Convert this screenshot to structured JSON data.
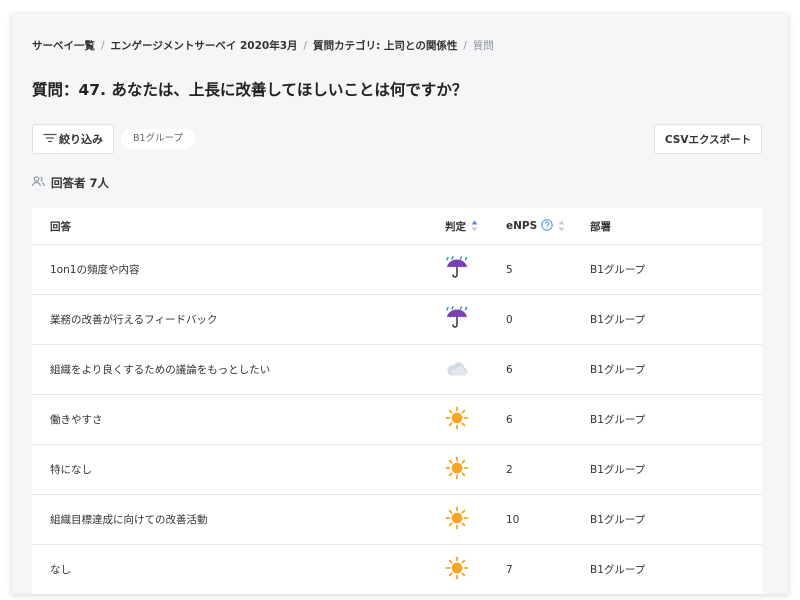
{
  "breadcrumb": {
    "items": [
      "サーベイ一覧",
      "エンゲージメントサーベイ 2020年3月",
      "質問カテゴリ: 上司との関係性"
    ],
    "separator": "/",
    "current": "質問"
  },
  "page_title": "質問：47. あなたは、上長に改善してほしいことは何ですか？",
  "toolbar": {
    "filter_label": "絞り込み",
    "filter_chip": "B1グループ",
    "csv_label": "CSVエクスポート"
  },
  "respondents_label": "回答者 7人",
  "table": {
    "headers": {
      "answer": "回答",
      "judge": "判定",
      "enps": "eNPS",
      "dept": "部署"
    },
    "rows": [
      {
        "answer": "1on1の頻度や内容",
        "judge": "umbrella-rain-icon",
        "enps": "5",
        "dept": "B1グループ"
      },
      {
        "answer": "業務の改善が行えるフィードバック",
        "judge": "umbrella-rain-icon",
        "enps": "0",
        "dept": "B1グループ"
      },
      {
        "answer": "組織をより良くするための議論をもっとしたい",
        "judge": "cloud-icon",
        "enps": "6",
        "dept": "B1グループ"
      },
      {
        "answer": "働きやすさ",
        "judge": "sun-icon",
        "enps": "6",
        "dept": "B1グループ"
      },
      {
        "answer": "特になし",
        "judge": "sun-icon",
        "enps": "2",
        "dept": "B1グループ"
      },
      {
        "answer": "組織目標達成に向けての改善活動",
        "judge": "sun-icon",
        "enps": "10",
        "dept": "B1グループ"
      },
      {
        "answer": "なし",
        "judge": "sun-icon",
        "enps": "7",
        "dept": "B1グループ"
      }
    ]
  },
  "colors": {
    "sort_active": "#4a90e2",
    "sun": "#f5a623",
    "umbrella": "#7b3fb5",
    "rain": "#3b82d6",
    "cloud": "#d5dbe3"
  }
}
